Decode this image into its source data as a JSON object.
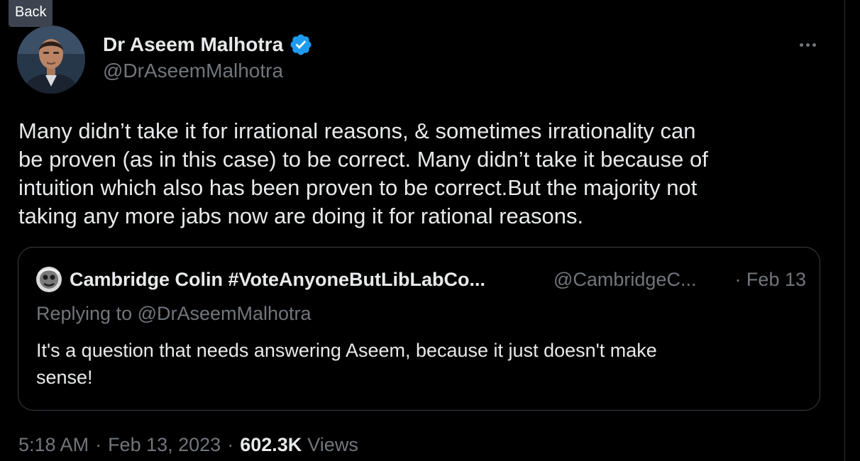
{
  "back_button": {
    "label": "Back"
  },
  "tweet": {
    "author": {
      "name": "Dr Aseem Malhotra",
      "handle": "@DrAseemMalhotra",
      "avatar_icon": "avatar-photo",
      "verified_icon": "verified-badge-icon"
    },
    "more_icon": "more-options-icon",
    "text": "Many didn’t take it for irrational reasons, & sometimes irrationality can\nbe proven (as in this case) to be correct. Many didn’t take it because of\nintuition which also has been proven to be correct.But the majority not\ntaking any more jabs now are doing it for rational reasons.",
    "quoted": {
      "name": "Cambridge Colin #VoteAnyoneButLibLabCo...",
      "handle": "@CambridgeC...",
      "date": "· Feb 13",
      "replying_to": "Replying to @DrAseemMalhotra",
      "text": "It's a question that needs answering Aseem, because it just doesn't make\nsense!"
    },
    "time": "5:18 AM",
    "separator": "·",
    "date": "Feb 13, 2023",
    "views_count": "602.3K",
    "views_label": "Views"
  },
  "colors": {
    "background": "#000000",
    "primary_text": "#e7e9ea",
    "secondary_text": "#71767b",
    "verified_blue": "#1d9bf0",
    "border": "#3a3f44"
  }
}
